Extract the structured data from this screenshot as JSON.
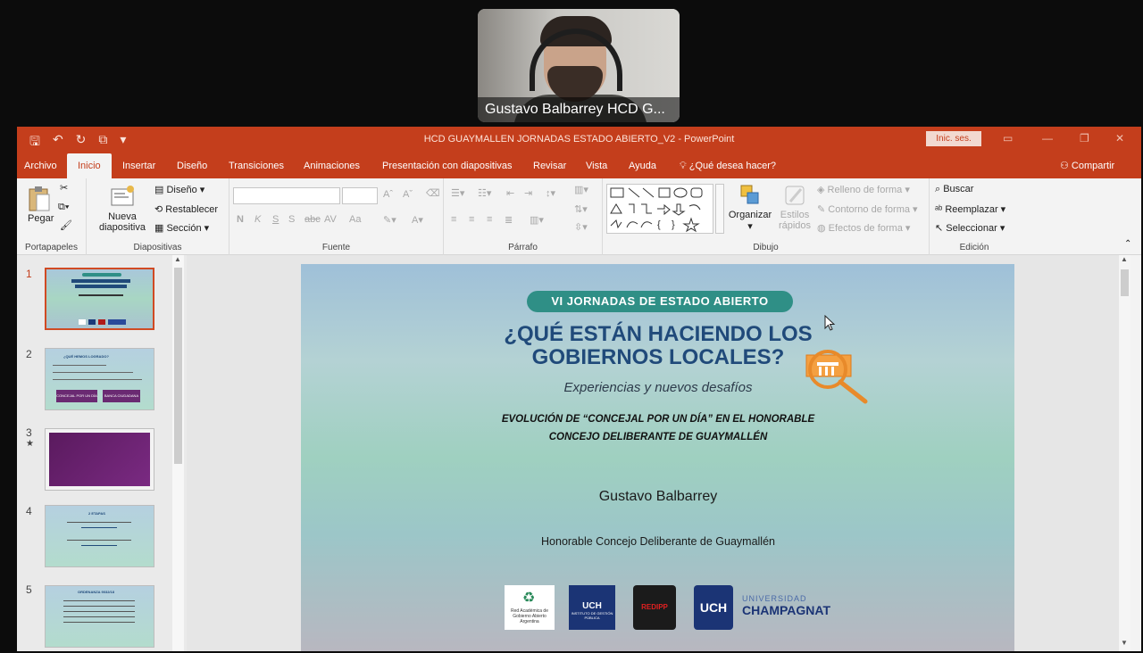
{
  "video": {
    "participant_name": "Gustavo Balbarrey HCD G..."
  },
  "titlebar": {
    "title": "HCD GUAYMALLEN JORNADAS ESTADO ABIERTO_V2  -  PowerPoint",
    "signin": "Inic. ses."
  },
  "tabs": [
    {
      "label": "Archivo"
    },
    {
      "label": "Inicio"
    },
    {
      "label": "Insertar"
    },
    {
      "label": "Diseño"
    },
    {
      "label": "Transiciones"
    },
    {
      "label": "Animaciones"
    },
    {
      "label": "Presentación con diapositivas"
    },
    {
      "label": "Revisar"
    },
    {
      "label": "Vista"
    },
    {
      "label": "Ayuda"
    },
    {
      "label": "¿Qué desea hacer?"
    }
  ],
  "share_label": "Compartir",
  "ribbon": {
    "portapapeles": {
      "label": "Portapapeles",
      "pegar": "Pegar"
    },
    "diapositivas": {
      "label": "Diapositivas",
      "nueva": "Nueva",
      "diapositiva": "diapositiva",
      "diseno": "Diseño",
      "restablecer": "Restablecer",
      "seccion": "Sección"
    },
    "fuente": {
      "label": "Fuente",
      "bold": "N",
      "italic": "K",
      "underline": "S",
      "strike": "S",
      "abc": "abc",
      "av": "AV",
      "aa": "Aa",
      "a_up": "A",
      "a_down": "A"
    },
    "parrafo": {
      "label": "Párrafo"
    },
    "dibujo": {
      "label": "Dibujo",
      "organizar": "Organizar",
      "estilos": "Estilos",
      "rapidos": "rápidos",
      "relleno": "Relleno de forma",
      "contorno": "Contorno de forma",
      "efectos": "Efectos de forma"
    },
    "edicion": {
      "label": "Edición",
      "buscar": "Buscar",
      "reemplazar": "Reemplazar",
      "seleccionar": "Seleccionar"
    }
  },
  "thumbnails": [
    {
      "num": "1",
      "mark": ""
    },
    {
      "num": "2",
      "mark": ""
    },
    {
      "num": "3",
      "mark": "★"
    },
    {
      "num": "4",
      "mark": ""
    },
    {
      "num": "5",
      "mark": ""
    }
  ],
  "thumb_text": {
    "t2_title": "¿QUÉ HEMOS LOGRADO?",
    "t2_logo1": "CONCEJAL POR UN DÍA",
    "t2_logo2": "BANCA CIUDADANA",
    "t4_title": "2 ETAPAS",
    "t5_title": "ORDENANZA 9032/18"
  },
  "slide": {
    "badge": "VI JORNADAS DE ESTADO ABIERTO",
    "title_line1": "¿QUÉ ESTÁN HACIENDO LOS",
    "title_line2": "GOBIERNOS LOCALES?",
    "subtitle": "Experiencias y nuevos desafíos",
    "evo_line1": "EVOLUCIÓN DE “CONCEJAL POR UN DÍA” EN EL HONORABLE",
    "evo_line2": "CONCEJO DELIBERANTE DE GUAYMALLÉN",
    "author": "Gustavo Balbarrey",
    "org": "Honorable Concejo Deliberante de Guaymallén",
    "logo1": "Red Académica de Gobierno Abierto",
    "logo1b": "Argentina",
    "logo2": "UCH",
    "logo2b": "INSTITUTO DE GESTIÓN PÚBLICA",
    "logo3": "REDIPP",
    "logo4": "UCH",
    "logo4_line1": "UNIVERSIDAD",
    "logo4_line2": "CHAMPAGNAT"
  },
  "colors": {
    "accent": "#c43e1c",
    "badge": "#2f8f86",
    "title": "#204a7a"
  }
}
